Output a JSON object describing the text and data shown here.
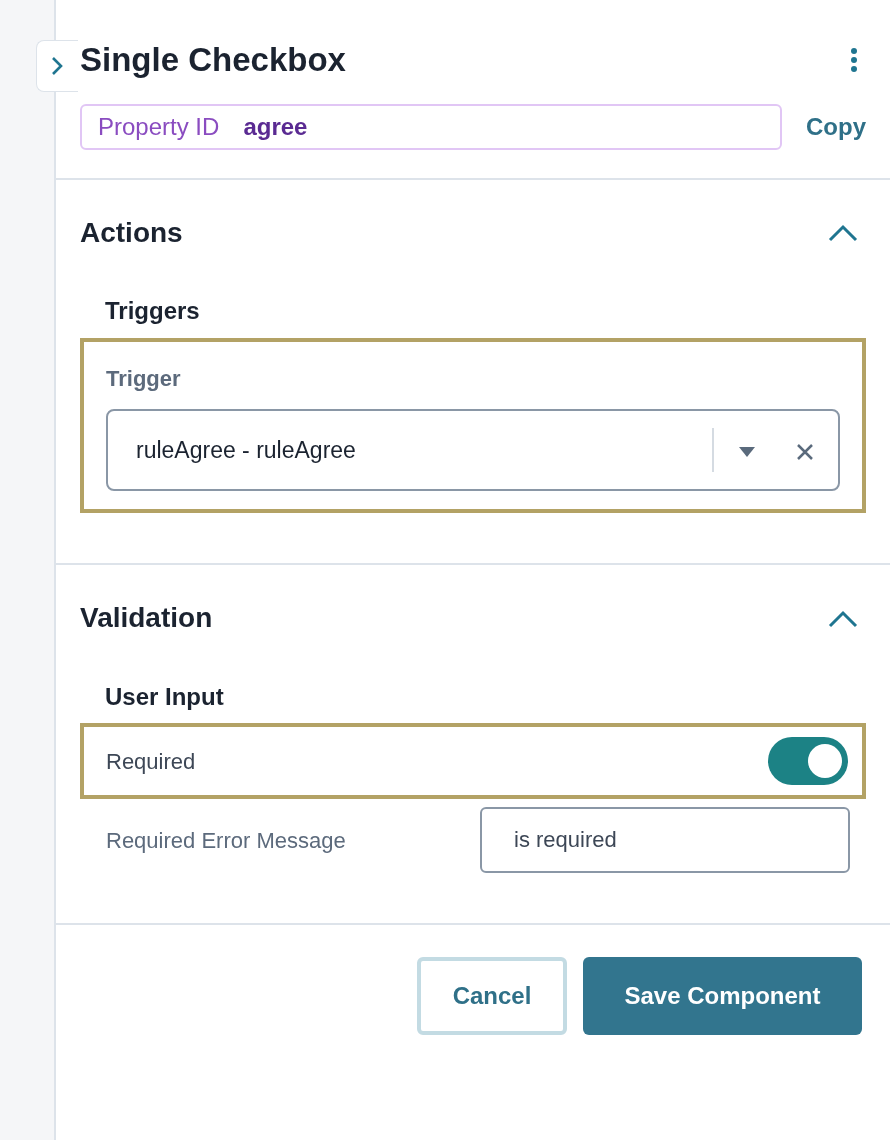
{
  "panel": {
    "title": "Single Checkbox",
    "property_id": {
      "label": "Property ID",
      "value": "agree"
    },
    "copy_label": "Copy"
  },
  "sections": [
    {
      "title": "Actions",
      "expanded": true,
      "subheading": "Triggers",
      "kind": "trigger",
      "highlighted": true,
      "field_label": "Trigger",
      "value": "ruleAgree - ruleAgree"
    },
    {
      "title": "Validation",
      "expanded": true,
      "subheading": "User Input",
      "kind": "validation",
      "highlighted": true,
      "toggle_label": "Required",
      "on": true,
      "error_label": "Required Error Message",
      "error_value": "is required"
    }
  ],
  "buttons": [
    {
      "label": "Cancel",
      "kind": "secondary"
    },
    {
      "label": "Save Component",
      "kind": "primary"
    }
  ]
}
